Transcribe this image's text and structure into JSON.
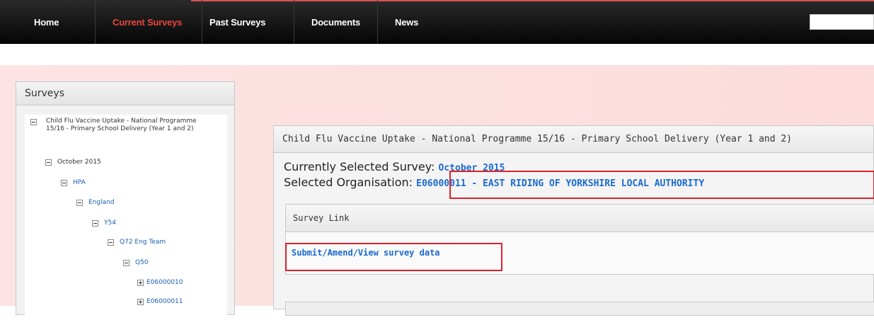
{
  "nav": {
    "items": [
      {
        "label": "Home",
        "active": false
      },
      {
        "label": "Current Surveys",
        "active": true
      },
      {
        "label": "Past Surveys",
        "active": false
      },
      {
        "label": "Documents",
        "active": false
      },
      {
        "label": "News",
        "active": false
      }
    ]
  },
  "sidebar": {
    "title": "Surveys",
    "tree": [
      {
        "label": "Child Flu Vaccine Uptake - National Programme 15/16 - Primary School Delivery (Year 1 and 2)",
        "toggle": "minus",
        "link": false
      },
      {
        "label": "October 2015",
        "toggle": "minus",
        "link": false
      },
      {
        "label": "HPA",
        "toggle": "minus",
        "link": true
      },
      {
        "label": "England",
        "toggle": "minus",
        "link": true
      },
      {
        "label": "Y54",
        "toggle": "minus",
        "link": true
      },
      {
        "label": "Q72 Eng Team",
        "toggle": "minus",
        "link": true
      },
      {
        "label": "Q50",
        "toggle": "minus",
        "link": true
      },
      {
        "label": "E06000010",
        "toggle": "plus",
        "link": true
      },
      {
        "label": "E06000011",
        "toggle": "plus",
        "link": true
      }
    ]
  },
  "main": {
    "panel_title": "Child Flu Vaccine Uptake - National Programme 15/16 - Primary School Delivery (Year 1 and 2)",
    "selected_survey_label": "Currently Selected Survey:",
    "selected_survey_value": "October 2015",
    "selected_org_label": "Selected Organisation:",
    "selected_org_value": "E06000011 - EAST RIDING OF YORKSHIRE LOCAL AUTHORITY",
    "survey_link_title": "Survey Link",
    "survey_link_text": "Submit/Amend/View survey data"
  },
  "colors": {
    "nav_active": "#e8463c",
    "link": "#1a6ad1",
    "highlight_border": "#e0202a",
    "page_band": "#fde3e3"
  },
  "icons": {
    "tree_collapse": "minus-box-icon",
    "tree_expand": "plus-box-icon"
  }
}
